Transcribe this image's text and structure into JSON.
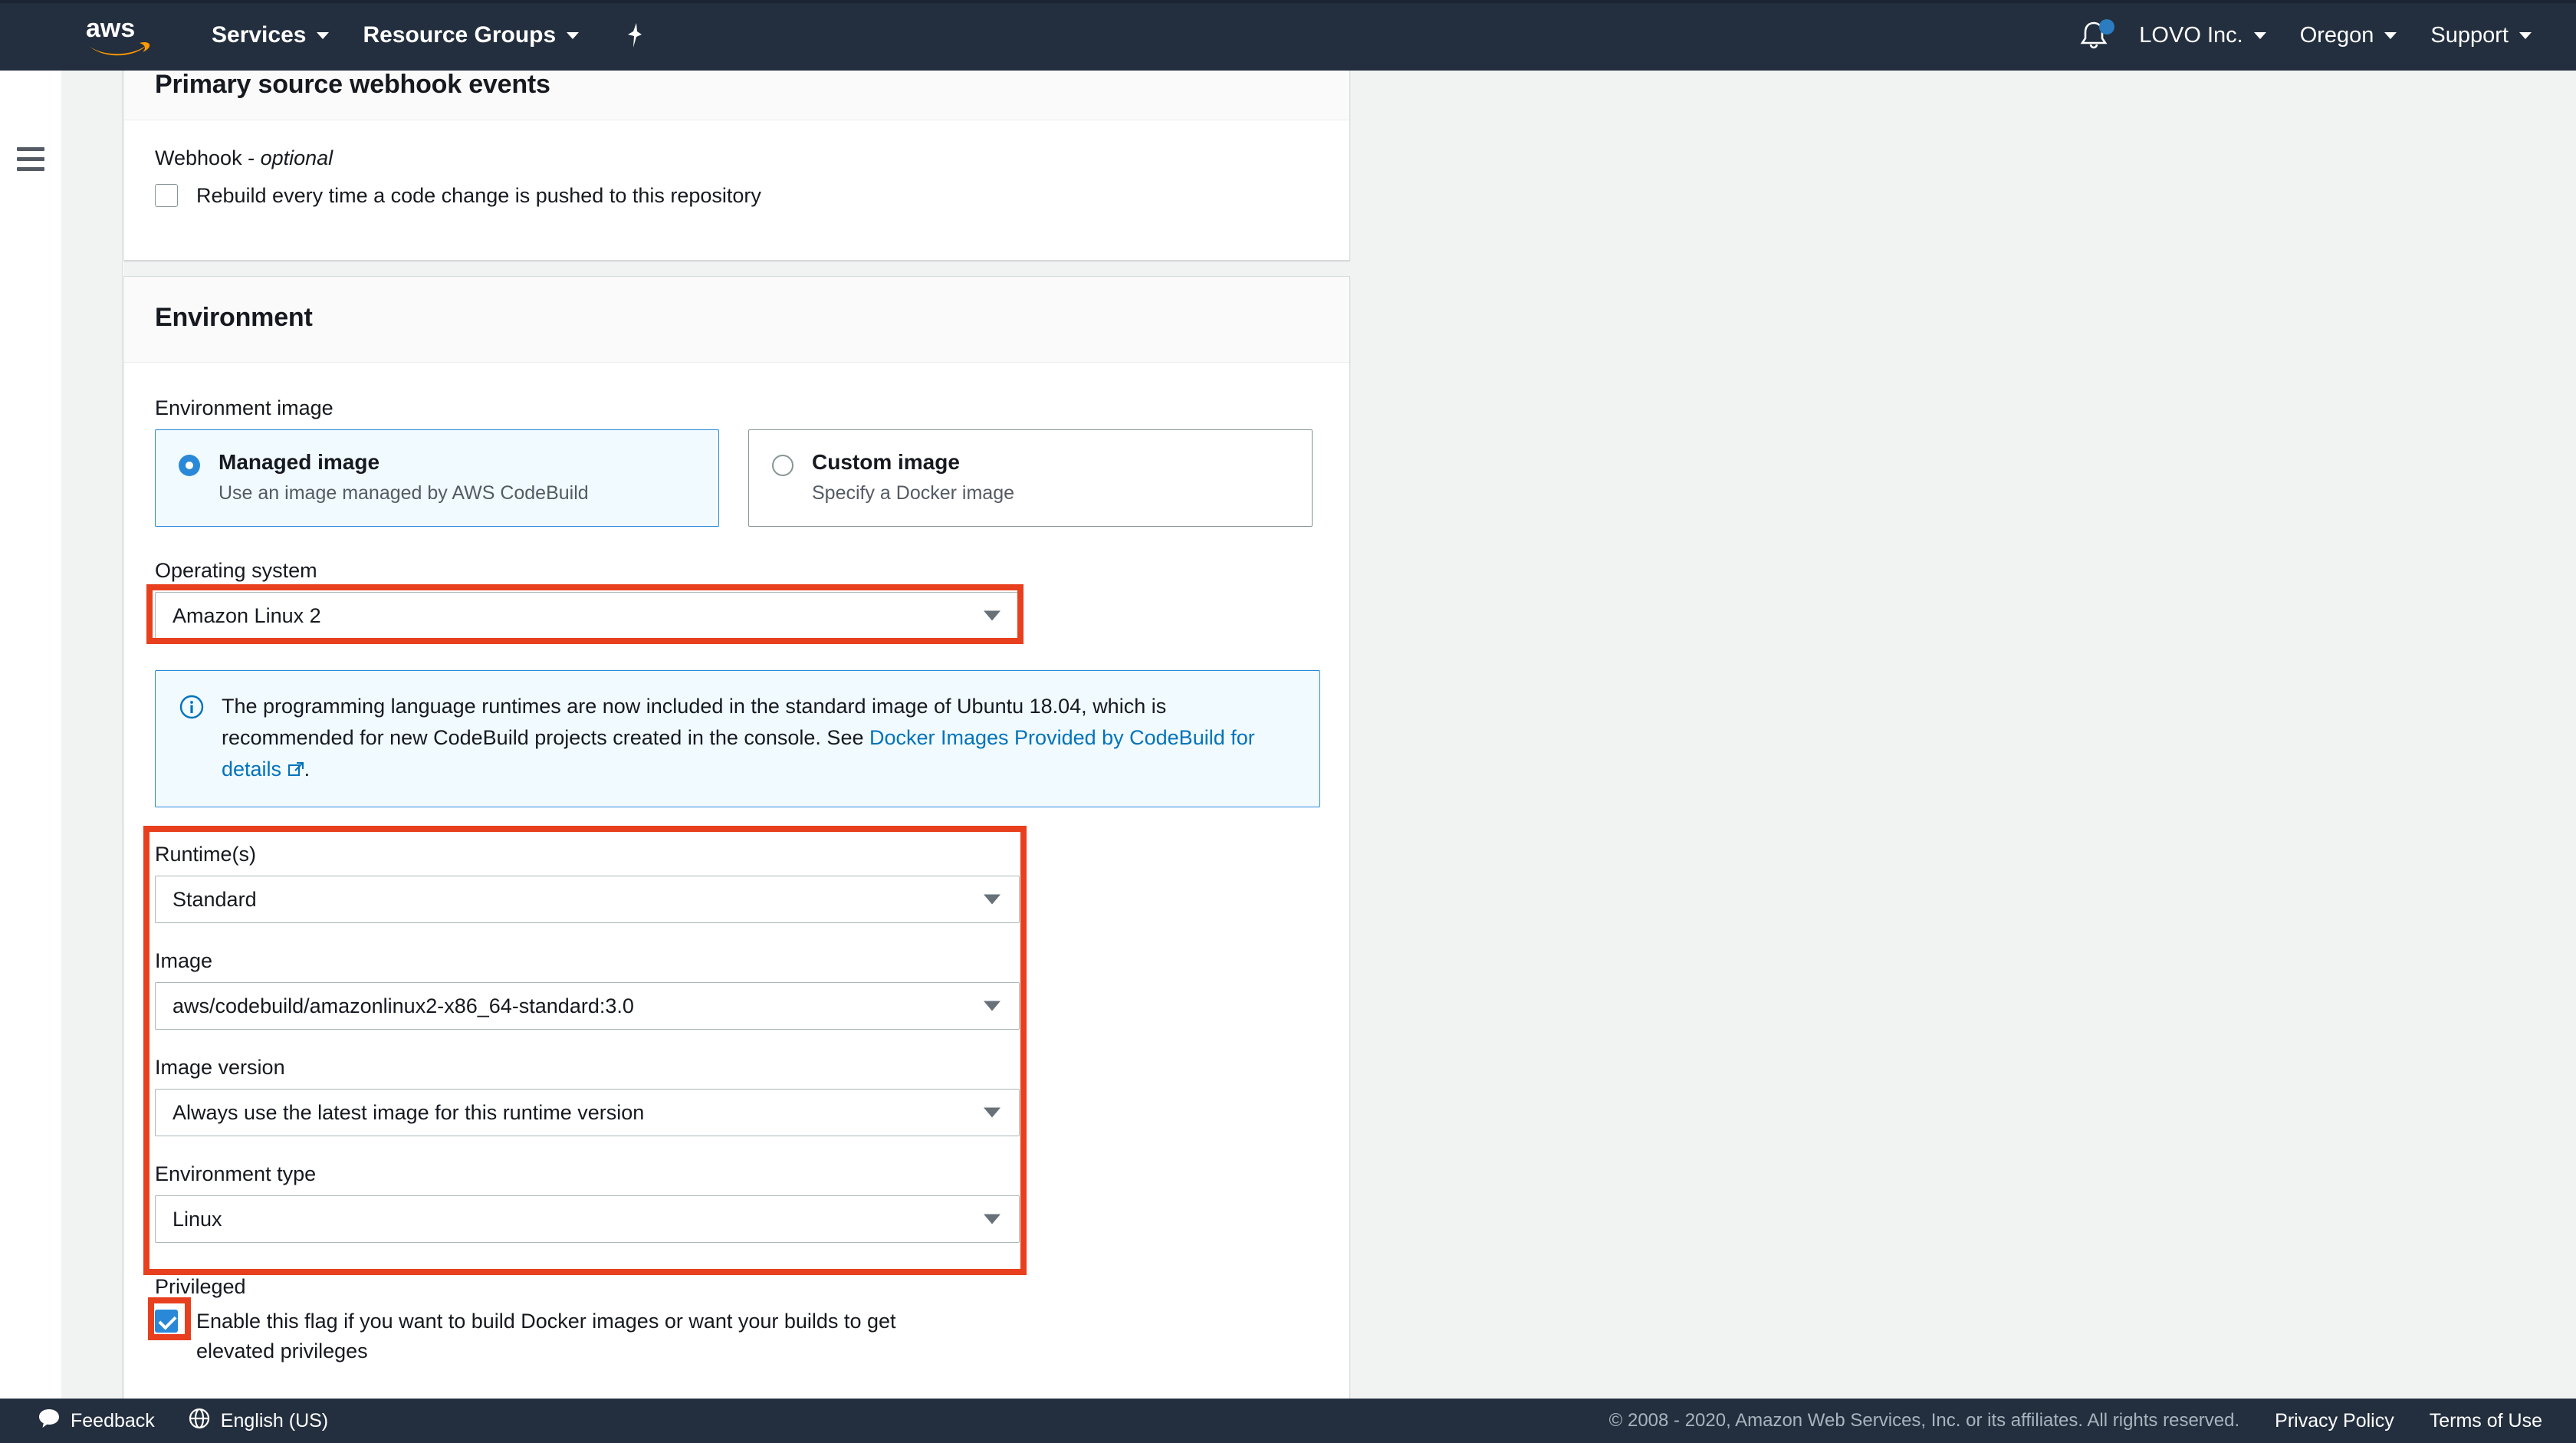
{
  "nav": {
    "logo": "aws-logo",
    "items": [
      {
        "label": "Services",
        "caret": true
      },
      {
        "label": "Resource Groups",
        "caret": true
      }
    ],
    "pin_icon": "pin-icon",
    "bell_icon": "bell-icon",
    "right_items": [
      {
        "label": "LOVO Inc.",
        "caret": true
      },
      {
        "label": "Oregon",
        "caret": true
      },
      {
        "label": "Support",
        "caret": true
      }
    ]
  },
  "webhook_card": {
    "title": "Primary source webhook events",
    "field_label": "Webhook - ",
    "field_label_optional": "optional",
    "checkbox_label": "Rebuild every time a code change is pushed to this repository",
    "checkbox_checked": false
  },
  "environment_card": {
    "title": "Environment",
    "environment_image_label": "Environment image",
    "options": [
      {
        "title": "Managed image",
        "sub": "Use an image managed by AWS CodeBuild",
        "selected": true
      },
      {
        "title": "Custom image",
        "sub": "Specify a Docker image",
        "selected": false
      }
    ],
    "operating_system": {
      "label": "Operating system",
      "value": "Amazon Linux 2"
    },
    "alert": {
      "text_before": "The programming language runtimes are now included in the standard image of Ubuntu 18.04, which is recommended for new CodeBuild projects created in the console. See ",
      "link_text": "Docker Images Provided by CodeBuild for details",
      "external_icon": "external-link-icon",
      "text_after": "."
    },
    "runtimes": {
      "label": "Runtime(s)",
      "value": "Standard"
    },
    "image": {
      "label": "Image",
      "value": "aws/codebuild/amazonlinux2-x86_64-standard:3.0"
    },
    "image_version": {
      "label": "Image version",
      "value": "Always use the latest image for this runtime version"
    },
    "environment_type": {
      "label": "Environment type",
      "value": "Linux"
    },
    "privileged": {
      "label": "Privileged",
      "checkbox_label": "Enable this flag if you want to build Docker images or want your builds to get elevated privileges",
      "checked": true
    }
  },
  "footer": {
    "feedback": "Feedback",
    "language": "English (US)",
    "copyright": "© 2008 - 2020, Amazon Web Services, Inc. or its affiliates. All rights reserved.",
    "privacy": "Privacy Policy",
    "terms": "Terms of Use"
  },
  "colors": {
    "nav_bg": "#232f3e",
    "accent_blue": "#2989d8",
    "link_blue": "#0073bb",
    "highlight_red": "#e8401e",
    "page_bg": "#f1f3f3"
  }
}
